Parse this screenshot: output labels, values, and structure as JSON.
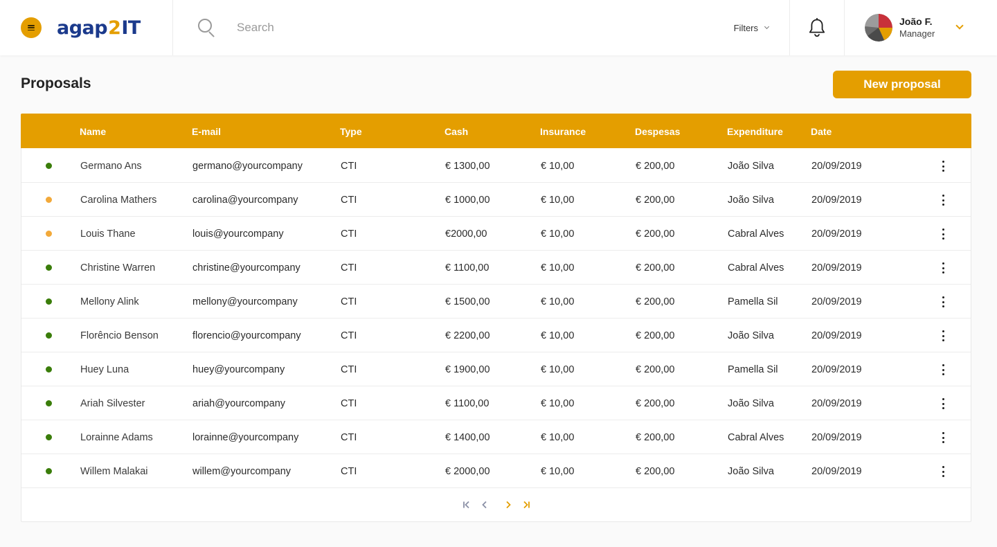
{
  "header": {
    "logo_main": "agap",
    "logo_two": "2",
    "logo_it": "IT",
    "search_placeholder": "Search",
    "filters_label": "Filters",
    "user": {
      "name": "João F.",
      "role": "Manager"
    }
  },
  "page": {
    "title": "Proposals",
    "new_button": "New proposal"
  },
  "colors": {
    "accent": "#e49e00",
    "logo_blue": "#1b3a8c",
    "status_active": "#3a7d0a",
    "status_pending": "#f2a93a"
  },
  "table": {
    "columns": [
      "Name",
      "E-mail",
      "Type",
      "Cash",
      "Insurance",
      "Despesas",
      "Expenditure",
      "Date"
    ],
    "rows": [
      {
        "status": "active",
        "name": "Germano Ans",
        "email": "germano@yourcompany",
        "type": "CTI",
        "cash": "€ 1300,00",
        "insurance": "€ 10,00",
        "despesas": "€ 200,00",
        "expenditure": "João Silva",
        "date": "20/09/2019"
      },
      {
        "status": "pending",
        "name": "Carolina Mathers",
        "email": "carolina@yourcompany",
        "type": "CTI",
        "cash": "€ 1000,00",
        "insurance": "€ 10,00",
        "despesas": "€ 200,00",
        "expenditure": "João Silva",
        "date": "20/09/2019"
      },
      {
        "status": "pending",
        "name": "Louis Thane",
        "email": "louis@yourcompany",
        "type": "CTI",
        "cash": "€2000,00",
        "insurance": "€ 10,00",
        "despesas": "€ 200,00",
        "expenditure": "Cabral Alves",
        "date": "20/09/2019"
      },
      {
        "status": "active",
        "name": "Christine Warren",
        "email": "christine@yourcompany",
        "type": "CTI",
        "cash": "€ 1100,00",
        "insurance": "€ 10,00",
        "despesas": "€ 200,00",
        "expenditure": "Cabral Alves",
        "date": "20/09/2019"
      },
      {
        "status": "active",
        "name": "Mellony Alink",
        "email": "mellony@yourcompany",
        "type": "CTI",
        "cash": "€ 1500,00",
        "insurance": "€ 10,00",
        "despesas": "€ 200,00",
        "expenditure": "Pamella Sil",
        "date": "20/09/2019"
      },
      {
        "status": "active",
        "name": "Florêncio Benson",
        "email": "florencio@yourcompany",
        "type": "CTI",
        "cash": "€ 2200,00",
        "insurance": "€ 10,00",
        "despesas": "€ 200,00",
        "expenditure": "João Silva",
        "date": "20/09/2019"
      },
      {
        "status": "active",
        "name": "Huey Luna",
        "email": "huey@yourcompany",
        "type": "CTI",
        "cash": "€ 1900,00",
        "insurance": "€ 10,00",
        "despesas": "€ 200,00",
        "expenditure": "Pamella Sil",
        "date": "20/09/2019"
      },
      {
        "status": "active",
        "name": "Ariah Silvester",
        "email": "ariah@yourcompany",
        "type": "CTI",
        "cash": "€ 1100,00",
        "insurance": "€ 10,00",
        "despesas": "€ 200,00",
        "expenditure": "João Silva",
        "date": "20/09/2019"
      },
      {
        "status": "active",
        "name": "Lorainne Adams",
        "email": "lorainne@yourcompany",
        "type": "CTI",
        "cash": "€ 1400,00",
        "insurance": "€ 10,00",
        "despesas": "€ 200,00",
        "expenditure": "Cabral Alves",
        "date": "20/09/2019"
      },
      {
        "status": "active",
        "name": "Willem Malakai",
        "email": "willem@yourcompany",
        "type": "CTI",
        "cash": "€ 2000,00",
        "insurance": "€ 10,00",
        "despesas": "€ 200,00",
        "expenditure": "João Silva",
        "date": "20/09/2019"
      }
    ]
  },
  "pagination": {
    "icons": [
      "first-page-icon",
      "prev-page-icon",
      "next-page-icon",
      "last-page-icon"
    ]
  }
}
